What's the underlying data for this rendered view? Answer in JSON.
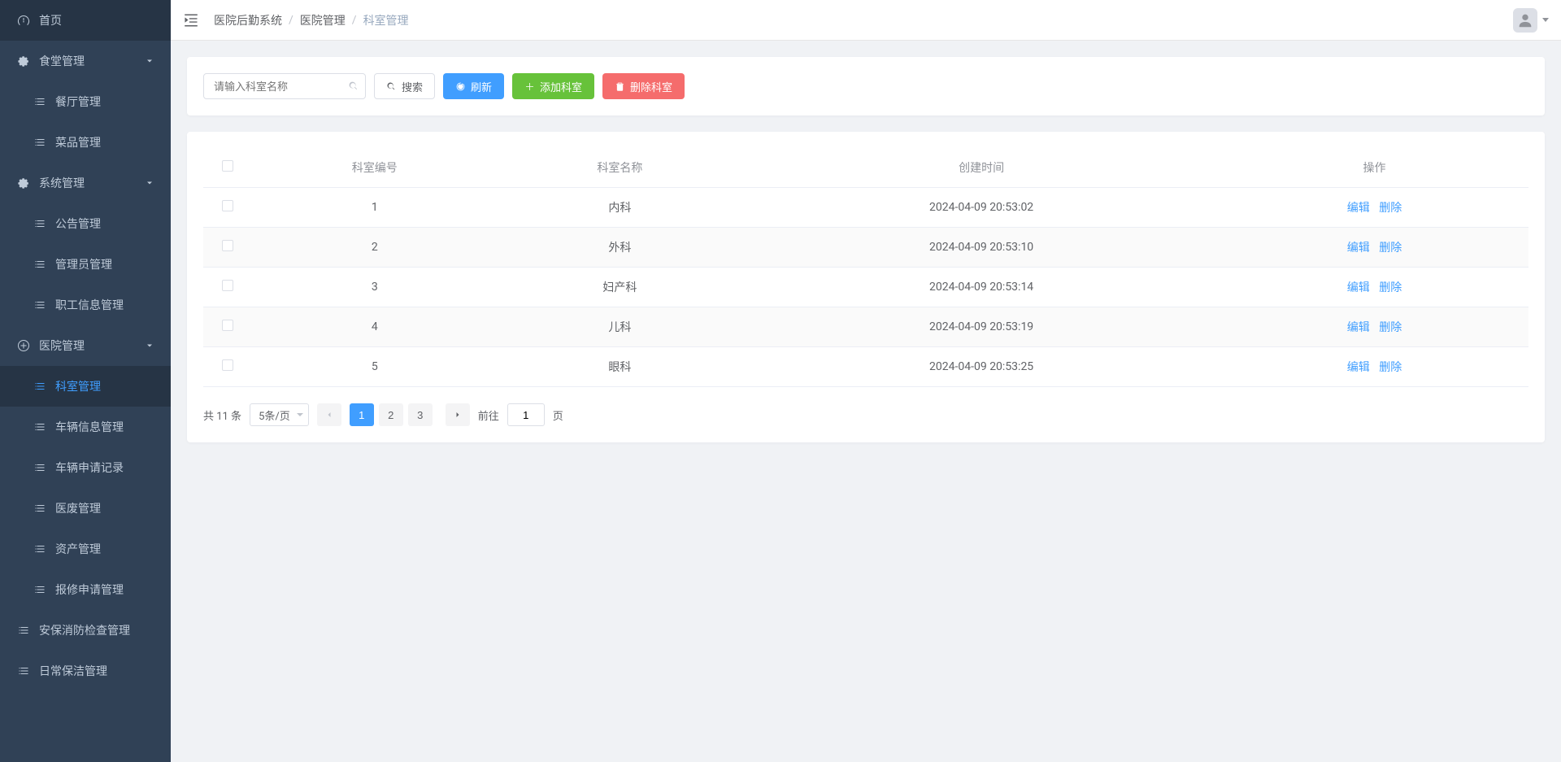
{
  "sidebar": [
    {
      "label": "首页",
      "icon": "dashboard",
      "type": "item"
    },
    {
      "label": "食堂管理",
      "icon": "gear",
      "type": "group",
      "open": true,
      "children": [
        {
          "label": "餐厅管理"
        },
        {
          "label": "菜品管理"
        }
      ]
    },
    {
      "label": "系统管理",
      "icon": "gear",
      "type": "group",
      "open": true,
      "children": [
        {
          "label": "公告管理"
        },
        {
          "label": "管理员管理"
        },
        {
          "label": "职工信息管理"
        }
      ]
    },
    {
      "label": "医院管理",
      "icon": "plus-circle",
      "type": "group",
      "open": true,
      "children": [
        {
          "label": "科室管理",
          "active": true
        },
        {
          "label": "车辆信息管理"
        },
        {
          "label": "车辆申请记录"
        },
        {
          "label": "医废管理"
        },
        {
          "label": "资产管理"
        },
        {
          "label": "报修申请管理"
        }
      ]
    },
    {
      "label": "安保消防检查管理",
      "icon": "list",
      "type": "item"
    },
    {
      "label": "日常保洁管理",
      "icon": "list",
      "type": "item"
    }
  ],
  "breadcrumb": {
    "root": "医院后勤系统",
    "mid": "医院管理",
    "current": "科室管理"
  },
  "toolbar": {
    "search_placeholder": "请输入科室名称",
    "search_btn": "搜索",
    "refresh_btn": "刷新",
    "add_btn": "添加科室",
    "delete_btn": "删除科室"
  },
  "table": {
    "headers": {
      "id": "科室编号",
      "name": "科室名称",
      "time": "创建时间",
      "ops": "操作"
    },
    "ops": {
      "edit": "编辑",
      "delete": "删除"
    },
    "rows": [
      {
        "id": "1",
        "name": "内科",
        "time": "2024-04-09 20:53:02"
      },
      {
        "id": "2",
        "name": "外科",
        "time": "2024-04-09 20:53:10"
      },
      {
        "id": "3",
        "name": "妇产科",
        "time": "2024-04-09 20:53:14"
      },
      {
        "id": "4",
        "name": "儿科",
        "time": "2024-04-09 20:53:19"
      },
      {
        "id": "5",
        "name": "眼科",
        "time": "2024-04-09 20:53:25"
      }
    ]
  },
  "pagination": {
    "total_text": "共 11 条",
    "page_size": "5条/页",
    "pages": [
      "1",
      "2",
      "3"
    ],
    "current": 1,
    "goto_label": "前往",
    "goto_value": "1",
    "goto_suffix": "页"
  }
}
